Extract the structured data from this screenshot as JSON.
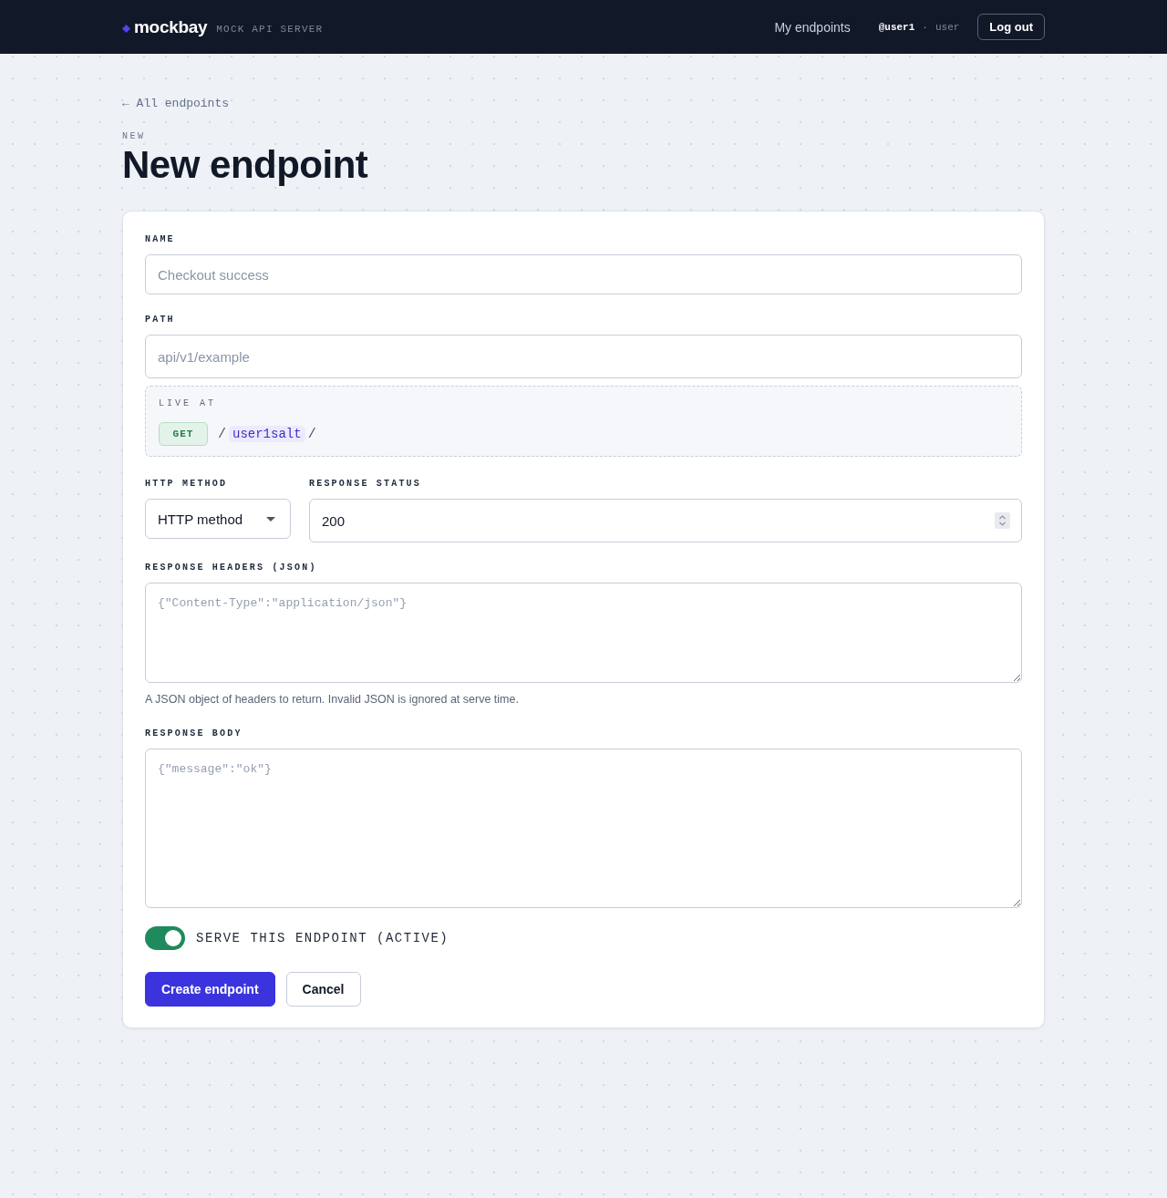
{
  "header": {
    "logo": "mockbay",
    "tagline": "MOCK API SERVER",
    "nav": [
      {
        "label": "My endpoints"
      }
    ],
    "user": {
      "handle": "@user1",
      "separator": "·",
      "role": "user"
    },
    "logout": "Log out"
  },
  "back_link": "← All endpoints",
  "eyebrow": "NEW",
  "title": "New endpoint",
  "form": {
    "name": {
      "label": "NAME",
      "placeholder": "Checkout success"
    },
    "path": {
      "label": "PATH",
      "placeholder": "api/v1/example"
    },
    "live_at": {
      "label": "LIVE AT",
      "method": "GET",
      "separator_1": "/",
      "segment": "user1salt",
      "separator_2": "/"
    },
    "http_method": {
      "label": "HTTP METHOD",
      "value": "HTTP method"
    },
    "response_status": {
      "label": "RESPONSE STATUS",
      "value": "200"
    },
    "response_headers": {
      "label": "RESPONSE HEADERS (JSON)",
      "placeholder": "{\"Content-Type\":\"application/json\"}",
      "hint": "A JSON object of headers to return. Invalid JSON is ignored at serve time."
    },
    "response_body": {
      "label": "RESPONSE BODY",
      "placeholder": "{\"message\":\"ok\"}"
    },
    "active_toggle": {
      "label": "SERVE THIS ENDPOINT (ACTIVE)",
      "on": true
    },
    "buttons": [
      {
        "label": "Create endpoint",
        "kind": "primary"
      },
      {
        "label": "Cancel",
        "kind": "secondary"
      }
    ]
  }
}
